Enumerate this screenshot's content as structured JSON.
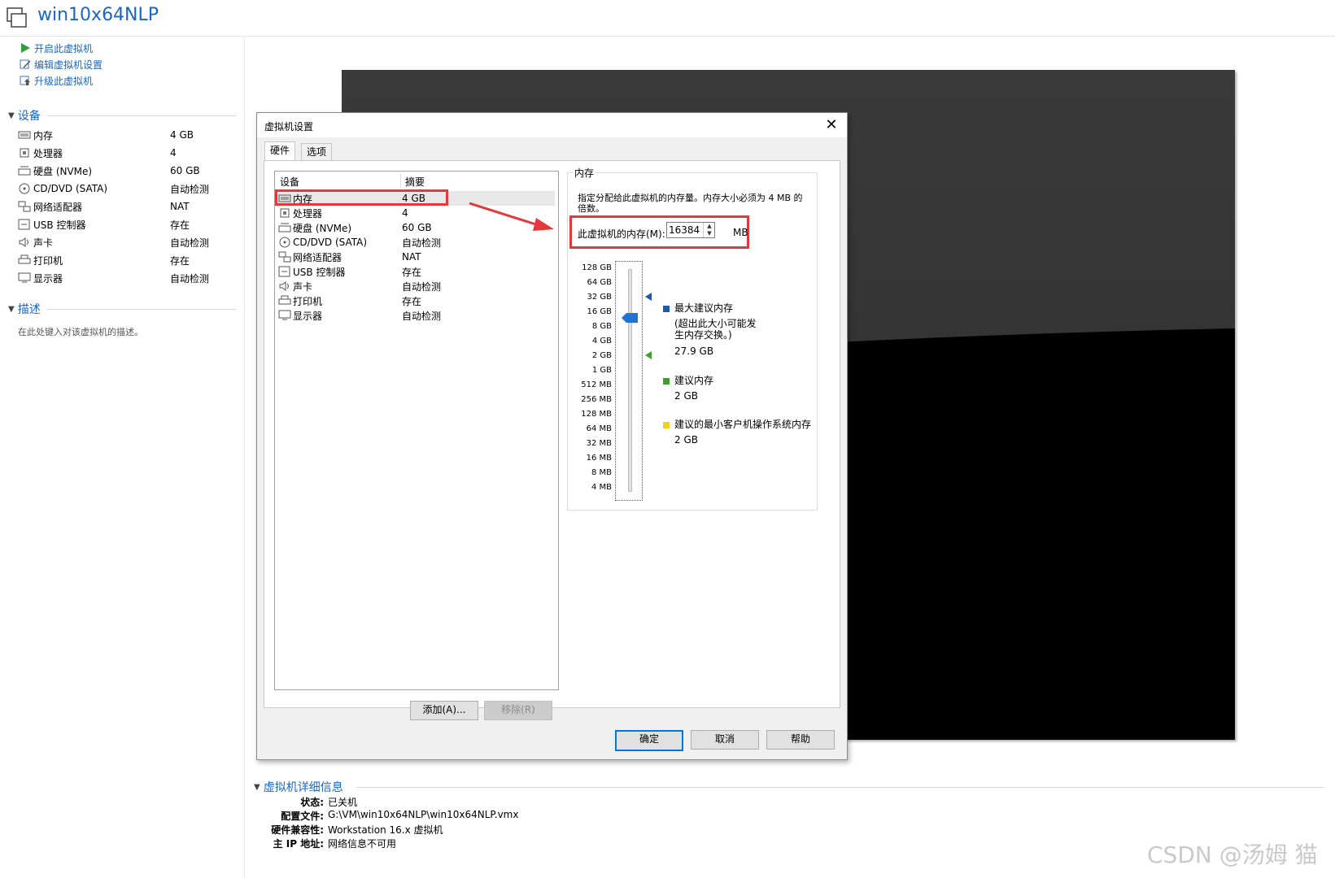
{
  "app": {
    "vm_name": "win10x64NLP"
  },
  "actions": [
    {
      "label": "开启此虚拟机",
      "icon": "play-icon"
    },
    {
      "label": "编辑虚拟机设置",
      "icon": "edit-settings-icon"
    },
    {
      "label": "升级此虚拟机",
      "icon": "upgrade-icon"
    }
  ],
  "devices_section": {
    "title": "设备"
  },
  "devices": [
    {
      "name": "内存",
      "value": "4 GB",
      "icon": "memory-icon"
    },
    {
      "name": "处理器",
      "value": "4",
      "icon": "processor-icon"
    },
    {
      "name": "硬盘 (NVMe)",
      "value": "60 GB",
      "icon": "hard-disk-icon"
    },
    {
      "name": "CD/DVD (SATA)",
      "value": "自动检测",
      "icon": "cd-dvd-icon"
    },
    {
      "name": "网络适配器",
      "value": "NAT",
      "icon": "network-adapter-icon"
    },
    {
      "name": "USB 控制器",
      "value": "存在",
      "icon": "usb-icon"
    },
    {
      "name": "声卡",
      "value": "自动检测",
      "icon": "sound-card-icon"
    },
    {
      "name": "打印机",
      "value": "存在",
      "icon": "printer-icon"
    },
    {
      "name": "显示器",
      "value": "自动检测",
      "icon": "display-icon"
    }
  ],
  "description_section": {
    "title": "描述",
    "placeholder": "在此处键入对该虚拟机的描述。"
  },
  "details": {
    "title": "虚拟机详细信息",
    "rows": [
      {
        "key": "状态:",
        "value": "已关机"
      },
      {
        "key": "配置文件:",
        "value": "G:\\VM\\win10x64NLP\\win10x64NLP.vmx"
      },
      {
        "key": "硬件兼容性:",
        "value": "Workstation 16.x 虚拟机"
      },
      {
        "key": "主 IP 地址:",
        "value": "网络信息不可用"
      }
    ]
  },
  "watermark": "CSDN @汤姆 猫",
  "dialog": {
    "title": "虚拟机设置",
    "close": "✕",
    "tabs": {
      "hardware": "硬件",
      "options": "选项"
    },
    "list_headers": {
      "device": "设备",
      "summary": "摘要"
    },
    "devices": [
      {
        "name": "内存",
        "value": "4 GB",
        "icon": "memory-icon"
      },
      {
        "name": "处理器",
        "value": "4",
        "icon": "processor-icon"
      },
      {
        "name": "硬盘 (NVMe)",
        "value": "60 GB",
        "icon": "hard-disk-icon"
      },
      {
        "name": "CD/DVD (SATA)",
        "value": "自动检测",
        "icon": "cd-dvd-icon"
      },
      {
        "name": "网络适配器",
        "value": "NAT",
        "icon": "network-adapter-icon"
      },
      {
        "name": "USB 控制器",
        "value": "存在",
        "icon": "usb-icon"
      },
      {
        "name": "声卡",
        "value": "自动检测",
        "icon": "sound-card-icon"
      },
      {
        "name": "打印机",
        "value": "存在",
        "icon": "printer-icon"
      },
      {
        "name": "显示器",
        "value": "自动检测",
        "icon": "display-icon"
      }
    ],
    "add_button": "添加(A)...",
    "remove_button": "移除(R)",
    "memory": {
      "group_title": "内存",
      "description": "指定分配给此虚拟机的内存量。内存大小必须为 4 MB 的倍数。",
      "field_label": "此虚拟机的内存(M):",
      "value": "16384",
      "unit": "MB",
      "scale": [
        "128 GB",
        "64 GB",
        "32 GB",
        "16 GB",
        "8 GB",
        "4 GB",
        "2 GB",
        "1 GB",
        "512 MB",
        "256 MB",
        "128 MB",
        "64 MB",
        "32 MB",
        "16 MB",
        "8 MB",
        "4 MB"
      ],
      "legend": [
        {
          "color": "#1e5aa8",
          "title": "最大建议内存",
          "note": "(超出此大小可能发生内存交换。)",
          "value": "27.9 GB"
        },
        {
          "color": "#3aa12c",
          "title": "建议内存",
          "value": "2 GB"
        },
        {
          "color": "#f2d21e",
          "title": "建议的最小客户机操作系统内存",
          "value": "2 GB"
        }
      ]
    },
    "buttons": {
      "ok": "确定",
      "cancel": "取消",
      "help": "帮助"
    }
  },
  "colors": {
    "accent": "#1a66c6",
    "highlight": "#e3393e"
  }
}
